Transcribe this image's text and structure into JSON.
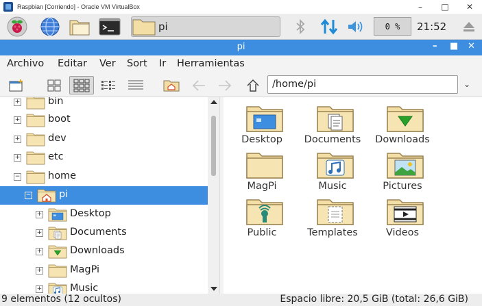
{
  "window": {
    "title": "Raspbian [Corriendo] - Oracle VM VirtualBox"
  },
  "panel": {
    "task_label": "pi",
    "cpu_label": "0 %",
    "clock": "21:52"
  },
  "fm": {
    "title": "pi",
    "menu": [
      "Archivo",
      "Editar",
      "Ver",
      "Sort",
      "Ir",
      "Herramientas"
    ],
    "path": "/home/pi",
    "tree": [
      {
        "label": "bin",
        "exp": "+"
      },
      {
        "label": "boot",
        "exp": "+"
      },
      {
        "label": "dev",
        "exp": "+"
      },
      {
        "label": "etc",
        "exp": "+"
      },
      {
        "label": "home",
        "exp": "−"
      },
      {
        "label": "pi",
        "exp": "−"
      },
      {
        "label": "Desktop",
        "exp": "+"
      },
      {
        "label": "Documents",
        "exp": "+"
      },
      {
        "label": "Downloads",
        "exp": "+"
      },
      {
        "label": "MagPi",
        "exp": "+"
      },
      {
        "label": "Music",
        "exp": "+"
      }
    ],
    "items": [
      {
        "label": "Desktop",
        "icon": "desktop-folder-icon"
      },
      {
        "label": "Documents",
        "icon": "documents-folder-icon"
      },
      {
        "label": "Downloads",
        "icon": "downloads-folder-icon"
      },
      {
        "label": "MagPi",
        "icon": "folder-icon"
      },
      {
        "label": "Music",
        "icon": "music-folder-icon"
      },
      {
        "label": "Pictures",
        "icon": "pictures-folder-icon"
      },
      {
        "label": "Public",
        "icon": "public-folder-icon"
      },
      {
        "label": "Templates",
        "icon": "templates-folder-icon"
      },
      {
        "label": "Videos",
        "icon": "videos-folder-icon"
      }
    ],
    "status_left": "9 elementos (12 ocultos)",
    "status_right": "Espacio libre: 20,5 GiB (total: 26,6 GiB)"
  },
  "colors": {
    "accent": "#3d8ee0",
    "folder": "#f3dfa6",
    "folder_stroke": "#9b8452"
  }
}
